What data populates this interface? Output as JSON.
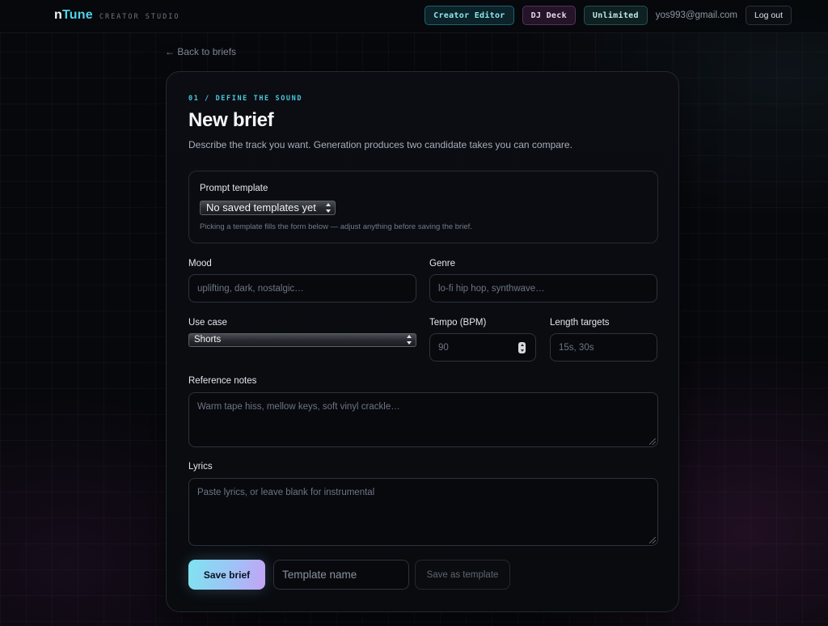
{
  "header": {
    "brand_prefix": "n",
    "brand_rest": "Tune",
    "brand_sub": "CREATOR STUDIO",
    "nav": {
      "creator_editor": "Creator Editor",
      "dj_deck": "DJ Deck",
      "plan": "Unlimited",
      "email": "yos993@gmail.com",
      "logout": "Log out"
    }
  },
  "back_link": "← Back to briefs",
  "form": {
    "step": "01 / DEFINE THE SOUND",
    "title": "New brief",
    "subtitle": "Describe the track you want. Generation produces two candidate takes you can compare.",
    "template": {
      "label": "Prompt template",
      "selected": "No saved templates yet",
      "hint": "Picking a template fills the form below — adjust anything before saving the brief."
    },
    "mood": {
      "label": "Mood",
      "placeholder": "uplifting, dark, nostalgic…"
    },
    "genre": {
      "label": "Genre",
      "placeholder": "lo-fi hip hop, synthwave…"
    },
    "use_case": {
      "label": "Use case",
      "selected": "Shorts"
    },
    "tempo": {
      "label": "Tempo (BPM)",
      "value": "90"
    },
    "length": {
      "label": "Length targets",
      "placeholder": "15s, 30s"
    },
    "reference": {
      "label": "Reference notes",
      "placeholder": "Warm tape hiss, mellow keys, soft vinyl crackle…"
    },
    "lyrics": {
      "label": "Lyrics",
      "placeholder": "Paste lyrics, or leave blank for instrumental"
    },
    "actions": {
      "save": "Save brief",
      "template_name_placeholder": "Template name",
      "save_template": "Save as template"
    }
  },
  "colors": {
    "accent": "#49c8de",
    "background": "#07080c",
    "card": "#0b0d12"
  }
}
